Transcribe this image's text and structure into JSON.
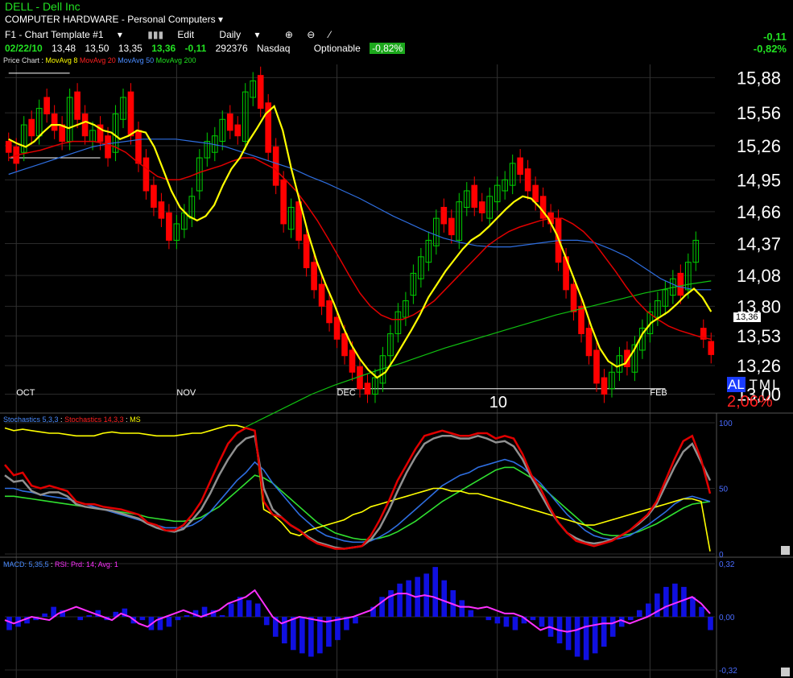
{
  "header": {
    "title": "DELL - Dell Inc",
    "subtitle": "COMPUTER HARDWARE - Personal Computers",
    "template": "F1 - Chart Template #1",
    "edit_label": "Edit",
    "period": "Daily",
    "quote": {
      "date": "02/22/10",
      "open": "13,48",
      "high": "13,50",
      "low": "13,35",
      "close": "13,36",
      "change": "-0,11",
      "volume": "292376",
      "exchange": "Nasdaq"
    },
    "optionable": "Optionable",
    "pct_pill": "-0,82%",
    "right_change": "-0,11",
    "right_pct": "-0,82%"
  },
  "legend": {
    "price_chart": "Price Chart",
    "ma8": "MovAvg 8",
    "ma20": "MovAvg 20",
    "ma50": "MovAvg 50",
    "ma200": "MovAvg 200",
    "stoch_fast": "Stochastics 5,3,3",
    "stoch_slow": "Stochastics 14,3,3",
    "ms": "MS",
    "macd": "MACD: 5,35,5",
    "rsi": "RSI: Prd: 14; Avg: 1"
  },
  "colors": {
    "up": "#00d000",
    "down": "#ff0000",
    "ma8": "#ffff00",
    "ma20": "#e00000",
    "ma50": "#2e6ee0",
    "ma200": "#10c010",
    "stoch_gray": "#909090",
    "macd_bar": "#1010e0",
    "rsi": "#ff30ff"
  },
  "ticker_box": {
    "symbol": "AL",
    "symbol2": "TML",
    "pct": "2,06%"
  },
  "price_label": "13,36",
  "chart_data": [
    {
      "type": "candlestick",
      "title": "",
      "ylim": [
        12.85,
        16.0
      ],
      "yticks": [
        "15,88",
        "15,56",
        "15,26",
        "14,95",
        "14,66",
        "14,37",
        "14,08",
        "13,80",
        "13,53",
        "13,26",
        "13,00"
      ],
      "ytick_values": [
        15.88,
        15.56,
        15.26,
        14.95,
        14.66,
        14.37,
        14.08,
        13.8,
        13.53,
        13.26,
        13.0
      ],
      "month_labels": [
        {
          "label": "OCT",
          "index": 1
        },
        {
          "label": "NOV",
          "index": 22
        },
        {
          "label": "DEC",
          "index": 43
        },
        {
          "label": "10",
          "index": 64
        },
        {
          "label": "FEB",
          "index": 84
        }
      ],
      "closes": [
        15.2,
        15.1,
        15.45,
        15.35,
        15.6,
        15.55,
        15.4,
        15.3,
        15.7,
        15.5,
        15.35,
        15.4,
        15.3,
        15.15,
        15.55,
        15.7,
        15.35,
        15.1,
        14.85,
        14.7,
        14.6,
        14.4,
        14.55,
        14.65,
        14.8,
        15.15,
        15.3,
        15.35,
        15.5,
        15.4,
        15.35,
        15.75,
        15.85,
        15.6,
        15.2,
        14.9,
        14.55,
        14.7,
        14.4,
        14.15,
        13.95,
        13.8,
        13.65,
        13.5,
        13.35,
        13.2,
        13.05,
        13.0,
        13.15,
        13.35,
        13.55,
        13.75,
        13.85,
        14.1,
        14.25,
        14.4,
        14.6,
        14.55,
        14.45,
        14.75,
        14.85,
        14.7,
        14.65,
        14.8,
        14.9,
        14.95,
        15.1,
        15.0,
        14.85,
        14.75,
        14.6,
        14.55,
        14.2,
        13.95,
        13.75,
        13.55,
        13.35,
        13.1,
        13.0,
        13.2,
        13.35,
        13.25,
        13.45,
        13.6,
        13.75,
        13.85,
        13.95,
        14.05,
        13.9,
        14.2,
        14.4,
        13.5,
        13.36
      ],
      "opens": [
        15.3,
        15.25,
        15.2,
        15.5,
        15.35,
        15.7,
        15.55,
        15.45,
        15.3,
        15.75,
        15.55,
        15.3,
        15.45,
        15.35,
        15.2,
        15.5,
        15.75,
        15.4,
        15.15,
        14.9,
        14.75,
        14.65,
        14.4,
        14.5,
        14.6,
        14.85,
        15.15,
        15.2,
        15.3,
        15.55,
        15.45,
        15.3,
        15.7,
        15.9,
        15.65,
        15.25,
        14.95,
        14.5,
        14.75,
        14.45,
        14.2,
        14.0,
        13.85,
        13.7,
        13.55,
        13.4,
        13.25,
        13.1,
        13.0,
        13.1,
        13.35,
        13.55,
        13.7,
        13.9,
        14.05,
        14.2,
        14.35,
        14.7,
        14.6,
        14.4,
        14.7,
        14.9,
        14.75,
        14.6,
        14.75,
        14.85,
        14.9,
        15.15,
        15.05,
        14.9,
        14.8,
        14.65,
        14.6,
        14.25,
        14.0,
        13.8,
        13.6,
        13.4,
        13.15,
        13.05,
        13.2,
        13.4,
        13.2,
        13.4,
        13.55,
        13.7,
        13.8,
        13.9,
        14.1,
        13.95,
        14.2,
        13.6,
        13.48
      ],
      "ma8": [
        15.32,
        15.28,
        15.25,
        15.3,
        15.38,
        15.45,
        15.45,
        15.42,
        15.45,
        15.48,
        15.45,
        15.4,
        15.38,
        15.32,
        15.35,
        15.4,
        15.38,
        15.25,
        15.05,
        14.85,
        14.7,
        14.62,
        14.58,
        14.62,
        14.72,
        14.9,
        15.05,
        15.15,
        15.3,
        15.42,
        15.55,
        15.62,
        15.4,
        15.05,
        14.75,
        14.45,
        14.2,
        14.0,
        13.82,
        13.62,
        13.45,
        13.32,
        13.22,
        13.15,
        13.2,
        13.32,
        13.45,
        13.58,
        13.72,
        13.88,
        14.0,
        14.12,
        14.22,
        14.32,
        14.4,
        14.45,
        14.52,
        14.6,
        14.68,
        14.75,
        14.8,
        14.78,
        14.7,
        14.6,
        14.45,
        14.25,
        14.05,
        13.85,
        13.62,
        13.42,
        13.3,
        13.25,
        13.28,
        13.4,
        13.55,
        13.65,
        13.7,
        13.75,
        13.82,
        13.9,
        13.96,
        13.88,
        13.75
      ],
      "ma20": [
        15.15,
        15.18,
        15.2,
        15.22,
        15.25,
        15.28,
        15.3,
        15.3,
        15.3,
        15.28,
        15.25,
        15.2,
        15.12,
        15.05,
        14.98,
        14.95,
        14.95,
        14.98,
        15.02,
        15.05,
        15.08,
        15.12,
        15.15,
        15.15,
        15.1,
        15.05,
        14.95,
        14.85,
        14.72,
        14.58,
        14.42,
        14.25,
        14.08,
        13.92,
        13.8,
        13.72,
        13.68,
        13.68,
        13.72,
        13.78,
        13.85,
        13.95,
        14.05,
        14.15,
        14.25,
        14.35,
        14.42,
        14.48,
        14.52,
        14.55,
        14.58,
        14.6,
        14.6,
        14.55,
        14.48,
        14.38,
        14.25,
        14.12,
        13.98,
        13.85,
        13.75,
        13.68,
        13.62,
        13.58,
        13.55,
        13.52,
        13.5
      ],
      "ma50": [
        15.0,
        15.05,
        15.1,
        15.15,
        15.2,
        15.25,
        15.28,
        15.3,
        15.32,
        15.32,
        15.32,
        15.3,
        15.28,
        15.25,
        15.2,
        15.15,
        15.1,
        15.05,
        14.98,
        14.92,
        14.85,
        14.78,
        14.7,
        14.62,
        14.55,
        14.48,
        14.42,
        14.38,
        14.35,
        14.34,
        14.34,
        14.36,
        14.38,
        14.4,
        14.4,
        14.38,
        14.32,
        14.25,
        14.15,
        14.05,
        13.98,
        13.95,
        13.95
      ],
      "ma200": [
        12.7,
        12.8,
        12.9,
        13.0,
        13.08,
        13.15,
        13.22,
        13.28,
        13.35,
        13.42,
        13.48,
        13.54,
        13.6,
        13.66,
        13.72,
        13.77,
        13.82,
        13.87,
        13.92,
        13.96,
        14.0,
        14.03
      ],
      "support_lines": [
        {
          "y": 13.05,
          "from": 43,
          "to": 86
        },
        {
          "y": 15.15,
          "from": 0,
          "to": 12
        },
        {
          "y": 15.92,
          "from": 0,
          "to": 8
        }
      ]
    },
    {
      "type": "line",
      "title": "",
      "ylim": [
        0,
        100
      ],
      "yticks": [
        "100",
        "50",
        "0"
      ],
      "ytick_values": [
        100,
        50,
        0
      ],
      "series": [
        {
          "name": "Stochastics 14,3,3",
          "values": [
            68,
            60,
            62,
            52,
            50,
            52,
            50,
            48,
            40,
            38,
            38,
            36,
            35,
            34,
            32,
            30,
            24,
            22,
            18,
            18,
            22,
            30,
            40,
            55,
            70,
            84,
            92,
            96,
            94,
            40,
            30,
            28,
            22,
            18,
            12,
            8,
            6,
            4,
            4,
            5,
            6,
            14,
            26,
            40,
            56,
            68,
            80,
            90,
            92,
            94,
            92,
            90,
            90,
            92,
            92,
            88,
            90,
            88,
            76,
            60,
            50,
            36,
            24,
            16,
            10,
            8,
            6,
            8,
            10,
            14,
            18,
            24,
            30,
            40,
            56,
            72,
            86,
            90,
            72,
            46
          ]
        },
        {
          "name": "Stochastics 5,3,3",
          "values": [
            60,
            55,
            56,
            48,
            45,
            47,
            47,
            44,
            38,
            36,
            35,
            34,
            33,
            31,
            29,
            27,
            23,
            20,
            18,
            17,
            19,
            26,
            34,
            46,
            60,
            72,
            82,
            88,
            90,
            50,
            34,
            28,
            22,
            18,
            13,
            9,
            7,
            5,
            4,
            5,
            6,
            11,
            20,
            33,
            48,
            62,
            74,
            84,
            88,
            90,
            90,
            88,
            88,
            90,
            88,
            85,
            86,
            82,
            72,
            58,
            46,
            34,
            24,
            16,
            12,
            9,
            8,
            9,
            11,
            14,
            18,
            23,
            29,
            38,
            52,
            66,
            78,
            84,
            70,
            56
          ]
        },
        {
          "name": "ms-blue",
          "values": [
            50,
            50,
            48,
            47,
            45,
            44,
            43,
            42,
            40,
            38,
            36,
            34,
            32,
            30,
            28,
            26,
            24,
            22,
            20,
            20,
            20,
            22,
            26,
            32,
            40,
            48,
            56,
            62,
            70,
            64,
            54,
            46,
            38,
            30,
            24,
            18,
            14,
            12,
            10,
            9,
            9,
            10,
            13,
            17,
            22,
            28,
            34,
            40,
            46,
            52,
            56,
            60,
            62,
            66,
            68,
            70,
            72,
            70,
            66,
            60,
            54,
            46,
            38,
            30,
            24,
            18,
            14,
            12,
            11,
            12,
            14,
            18,
            22,
            27,
            32,
            38,
            42,
            44,
            42,
            40
          ]
        },
        {
          "name": "ms-green",
          "values": [
            44,
            44,
            43,
            42,
            41,
            40,
            39,
            38,
            37,
            36,
            35,
            34,
            33,
            32,
            31,
            30,
            28,
            27,
            26,
            25,
            25,
            26,
            28,
            32,
            36,
            42,
            48,
            54,
            60,
            58,
            54,
            48,
            42,
            36,
            30,
            24,
            20,
            16,
            14,
            12,
            11,
            11,
            12,
            14,
            17,
            21,
            25,
            30,
            35,
            40,
            44,
            48,
            52,
            56,
            60,
            64,
            66,
            66,
            62,
            58,
            52,
            46,
            40,
            34,
            28,
            22,
            18,
            15,
            14,
            14,
            15,
            17,
            20,
            23,
            27,
            31,
            35,
            38,
            39,
            40
          ]
        },
        {
          "name": "MS",
          "values": [
            96,
            94,
            95,
            94,
            93,
            92,
            92,
            91,
            90,
            90,
            90,
            92,
            93,
            92,
            92,
            92,
            91,
            90,
            90,
            90,
            91,
            92,
            92,
            94,
            96,
            98,
            98,
            96,
            94,
            34,
            30,
            24,
            16,
            14,
            18,
            20,
            22,
            24,
            26,
            30,
            32,
            36,
            38,
            40,
            42,
            44,
            46,
            48,
            50,
            50,
            48,
            48,
            46,
            46,
            44,
            42,
            40,
            38,
            36,
            34,
            32,
            30,
            28,
            26,
            24,
            22,
            22,
            24,
            26,
            28,
            30,
            32,
            34,
            36,
            38,
            40,
            42,
            42,
            40,
            2
          ]
        }
      ]
    },
    {
      "type": "bar",
      "title": "",
      "ylim": [
        -0.32,
        0.32
      ],
      "yticks": [
        "0,32",
        "0,00",
        "-0,32"
      ],
      "ytick_values": [
        0.32,
        0.0,
        -0.32
      ],
      "macd": [
        -0.08,
        -0.06,
        -0.04,
        -0.02,
        0.02,
        0.06,
        0.04,
        0.0,
        -0.02,
        0.01,
        0.04,
        -0.02,
        0.03,
        0.05,
        -0.04,
        -0.02,
        -0.08,
        -0.08,
        -0.06,
        -0.02,
        0.01,
        0.04,
        0.06,
        0.04,
        0.01,
        0.08,
        0.12,
        0.1,
        0.08,
        -0.05,
        -0.12,
        -0.16,
        -0.2,
        -0.22,
        -0.24,
        -0.22,
        -0.18,
        -0.14,
        -0.08,
        -0.04,
        0.0,
        0.06,
        0.12,
        0.16,
        0.2,
        0.22,
        0.24,
        0.26,
        0.3,
        0.22,
        0.16,
        0.1,
        0.04,
        0.0,
        -0.02,
        -0.04,
        -0.06,
        -0.08,
        -0.04,
        -0.02,
        -0.06,
        -0.12,
        -0.16,
        -0.2,
        -0.24,
        -0.26,
        -0.22,
        -0.18,
        -0.12,
        -0.06,
        -0.02,
        0.04,
        0.08,
        0.14,
        0.18,
        0.2,
        0.18,
        0.12,
        0.06,
        -0.08
      ],
      "rsi": [
        -0.02,
        -0.04,
        -0.02,
        0.0,
        -0.01,
        -0.02,
        0.02,
        0.04,
        0.06,
        0.04,
        0.02,
        0.0,
        -0.02,
        0.02,
        0.0,
        -0.04,
        -0.06,
        -0.02,
        0.0,
        0.02,
        0.04,
        0.02,
        0.0,
        0.02,
        0.04,
        0.08,
        0.1,
        0.12,
        0.16,
        0.08,
        0.0,
        -0.04,
        -0.02,
        0.0,
        -0.01,
        -0.02,
        -0.03,
        -0.02,
        -0.01,
        0.0,
        0.02,
        0.04,
        0.08,
        0.12,
        0.14,
        0.14,
        0.12,
        0.13,
        0.12,
        0.1,
        0.08,
        0.06,
        0.06,
        0.05,
        0.06,
        0.04,
        0.02,
        0.02,
        0.0,
        -0.04,
        -0.08,
        -0.06,
        -0.08,
        -0.09,
        -0.08,
        -0.06,
        -0.05,
        -0.04,
        -0.04,
        -0.02,
        -0.04,
        -0.02,
        0.0,
        0.03,
        0.06,
        0.08,
        0.1,
        0.12,
        0.08,
        0.02
      ]
    }
  ]
}
